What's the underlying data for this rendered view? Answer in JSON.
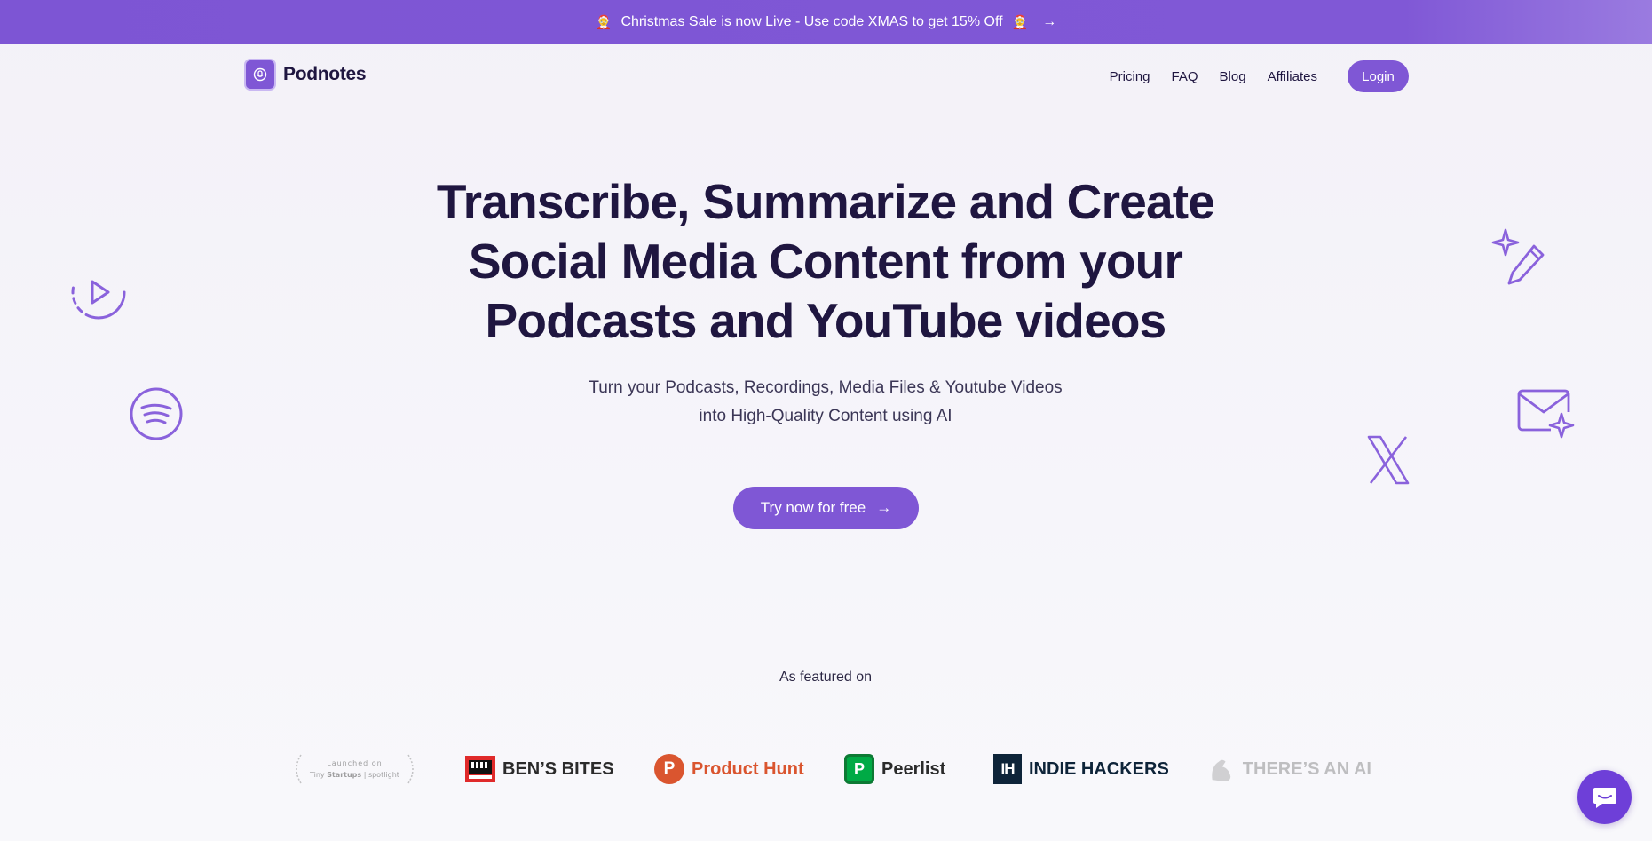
{
  "banner": {
    "emoji_left": "🤶",
    "text": "Christmas Sale is now Live - Use code XMAS to get 15% Off",
    "emoji_right": "🤶",
    "arrow": "→"
  },
  "nav": {
    "brand": "Podnotes",
    "links": [
      "Pricing",
      "FAQ",
      "Blog",
      "Affiliates"
    ],
    "login_label": "Login"
  },
  "hero": {
    "title_lines": [
      "Transcribe, Summarize and Create",
      "Social Media Content from your",
      "Podcasts and YouTube videos"
    ],
    "subtitle_lines": [
      "Turn your Podcasts, Recordings, Media Files & Youtube Videos",
      "into High-Quality Content using AI"
    ],
    "cta_label": "Try now for free",
    "cta_arrow": "→"
  },
  "decor_icons": [
    "play-circle-icon",
    "spotify-icon",
    "magic-pen-icon",
    "mail-sparkle-icon",
    "x-logo-icon"
  ],
  "featured": {
    "label": "As featured on",
    "logos": [
      {
        "name": "tiny-startups",
        "line1": "Launched on",
        "line2_bold": "Startups",
        "line2_pre": "Tiny ",
        "line2_post": " | spotlight"
      },
      {
        "name": "bens-bites",
        "text": "BEN’S BITES"
      },
      {
        "name": "product-hunt",
        "text": "Product Hunt",
        "badge": "P"
      },
      {
        "name": "peerlist",
        "text": "Peerlist",
        "badge": "P"
      },
      {
        "name": "indie-hackers",
        "text": "INDIE HACKERS",
        "badge": "IH"
      },
      {
        "name": "theres-an-ai",
        "text": "THERE’S AN AI"
      }
    ]
  },
  "colors": {
    "accent": "#7f57d5",
    "text_dark": "#1f1640",
    "product_hunt": "#da552f",
    "peerlist": "#00aa45",
    "indie_hackers": "#0e2439"
  }
}
